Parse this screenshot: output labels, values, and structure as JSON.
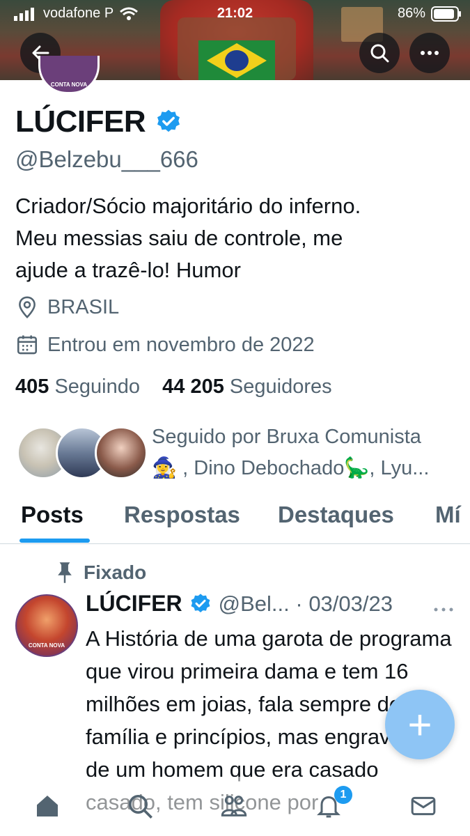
{
  "status_bar": {
    "carrier": "vodafone P",
    "time": "21:02",
    "battery": "86%"
  },
  "header": {
    "back_icon": "back-arrow-icon",
    "search_icon": "search-icon",
    "more_icon": "more-icon"
  },
  "avatar_peek_label": "CONTA NOVA",
  "profile": {
    "name": "LÚCIFER",
    "handle": "@Belzebu___666",
    "bio": [
      "Criador/Sócio majoritário do inferno.",
      "Meu messias saiu de controle, me",
      "ajude a trazê-lo! Humor"
    ],
    "location": "BRASIL",
    "joined": "Entrou em novembro de 2022",
    "following_count": "405",
    "following_label": "Seguindo",
    "followers_count": "44 205",
    "followers_label": "Seguidores",
    "followed_by_line1": "Seguido por Bruxa Comunista",
    "followed_by_line2": "🧙‍♀️ , Dino Debochado🦕, Lyu..."
  },
  "tabs": [
    "Posts",
    "Respostas",
    "Destaques",
    "Mí"
  ],
  "pinned": {
    "label": "Fixado",
    "name": "LÚCIFER",
    "handle_date": "@Bel... · 03/03/23",
    "avatar_label": "CONTA NOVA",
    "text": "A História de uma garota de programa que virou primeira dama e tem 16 milhões em joias, fala sempre de  família e princípios, mas engravidou de um homem que era casado casado, tem silicone por"
  },
  "fab_label": "+",
  "notification_badge": "1",
  "colors": {
    "verified": "#1d9bf0",
    "accent": "#1d9bf0",
    "muted": "#536471"
  }
}
